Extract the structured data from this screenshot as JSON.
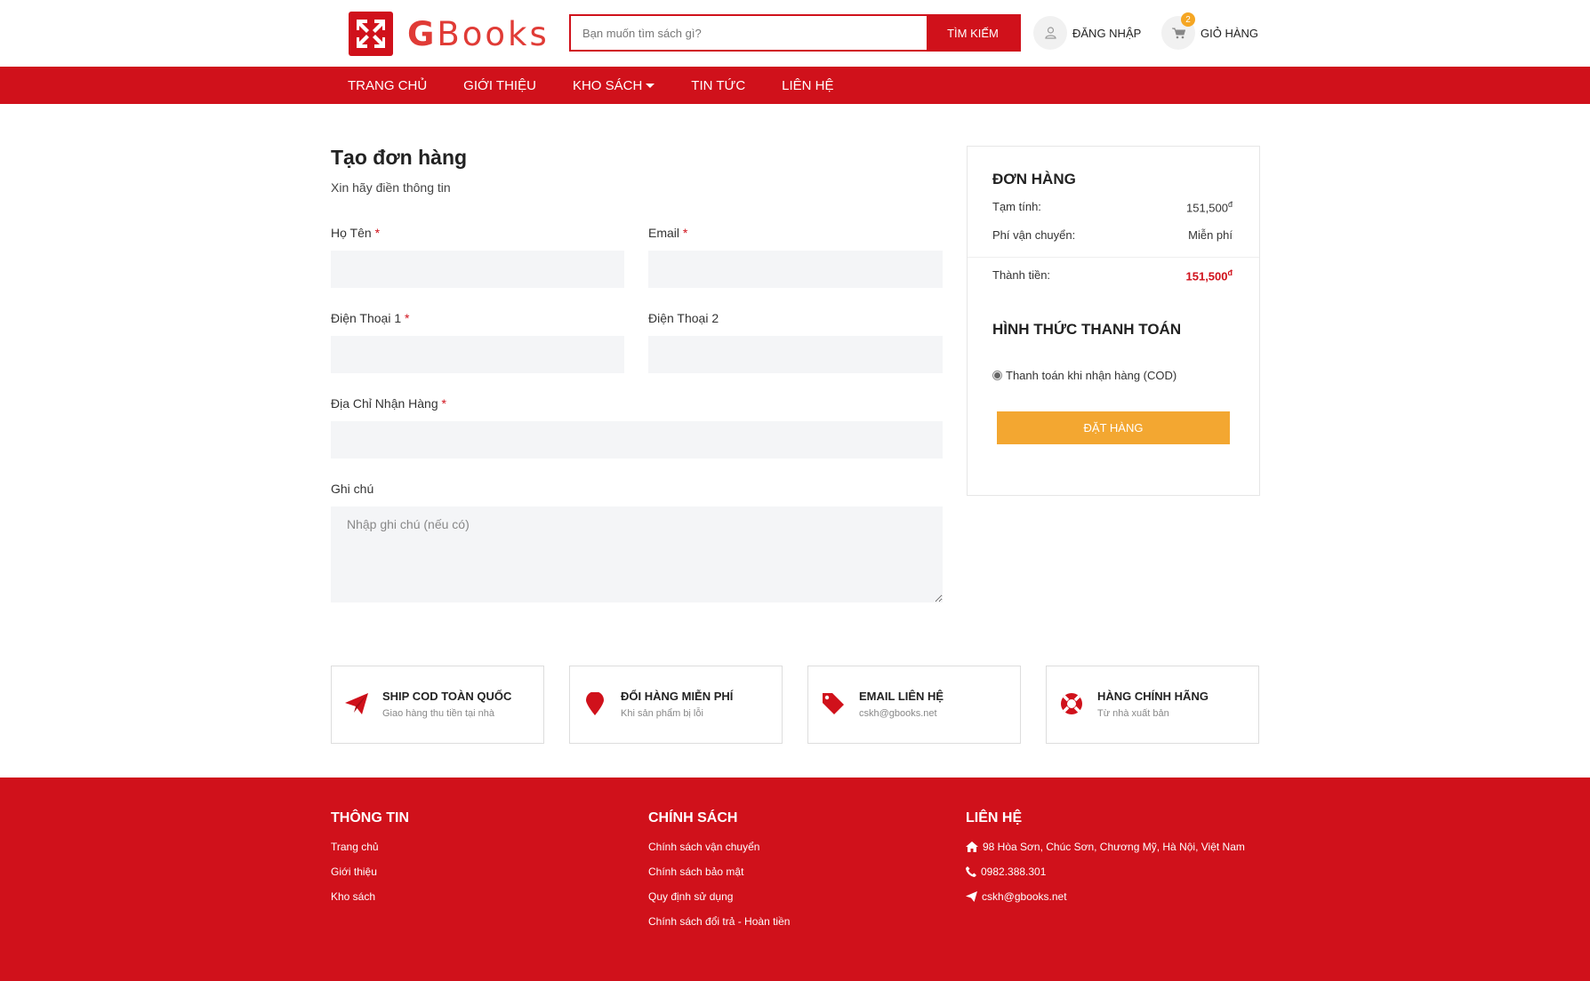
{
  "brand": {
    "name_first": "G",
    "name_rest": "Books",
    "color": "#d0111b"
  },
  "header": {
    "search_placeholder": "Bạn muốn tìm sách gì?",
    "search_button": "TÌM KIẾM",
    "login_label": "ĐĂNG NHẬP",
    "cart_label": "GIỎ HÀNG",
    "cart_count": "2"
  },
  "nav": {
    "items": [
      "TRANG CHỦ",
      "GIỚI THIỆU",
      "KHO SÁCH",
      "TIN TỨC",
      "LIÊN HỆ"
    ]
  },
  "form": {
    "title": "Tạo đơn hàng",
    "subtitle": "Xin hãy điền thông tin",
    "name_label": "Họ Tên",
    "email_label": "Email",
    "phone1_label": "Điện Thoại 1",
    "phone2_label": "Điện Thoại 2",
    "address_label": "Địa Chỉ Nhận Hàng",
    "note_label": "Ghi chú",
    "note_placeholder": "Nhập ghi chú (nếu có)",
    "required_mark": "*"
  },
  "summary": {
    "title": "ĐƠN HÀNG",
    "subtotal_label": "Tạm tính:",
    "subtotal_value": "151,500",
    "shipping_label": "Phí vận chuyển:",
    "shipping_value": "Miễn phí",
    "total_label": "Thành tiền:",
    "total_value": "151,500",
    "currency": "đ",
    "payment_title": "HÌNH THỨC THANH TOÁN",
    "payment_option": "Thanh toán khi nhận hàng (COD)",
    "order_button": "ĐẶT HÀNG"
  },
  "features": [
    {
      "title": "SHIP COD TOÀN QUỐC",
      "sub": "Giao hàng thu tiền tại nhà",
      "icon": "paper-plane-icon"
    },
    {
      "title": "ĐỔI HÀNG MIỄN PHÍ",
      "sub": "Khi sản phẩm bị lỗi",
      "icon": "map-pin-icon"
    },
    {
      "title": "EMAIL LIÊN HỆ",
      "sub": "cskh@gbooks.net",
      "icon": "tag-icon"
    },
    {
      "title": "HÀNG CHÍNH HÃNG",
      "sub": "Từ nhà xuất bản",
      "icon": "lifebuoy-icon"
    }
  ],
  "footer": {
    "info_title": "THÔNG TIN",
    "info_links": [
      "Trang chủ",
      "Giới thiệu",
      "Kho sách"
    ],
    "policy_title": "CHÍNH SÁCH",
    "policy_links": [
      "Chính sách vận chuyển",
      "Chính sách bảo mật",
      "Quy định sử dụng",
      "Chính sách đổi trả - Hoàn tiền"
    ],
    "contact_title": "LIÊN HỆ",
    "address": "98 Hòa Sơn, Chúc Sơn, Chương Mỹ, Hà Nội, Việt Nam",
    "phone": "0982.388.301",
    "email": "cskh@gbooks.net"
  },
  "colors": {
    "primary": "#d0111b",
    "accent": "#f3a731",
    "field_bg": "#f4f5f7"
  }
}
